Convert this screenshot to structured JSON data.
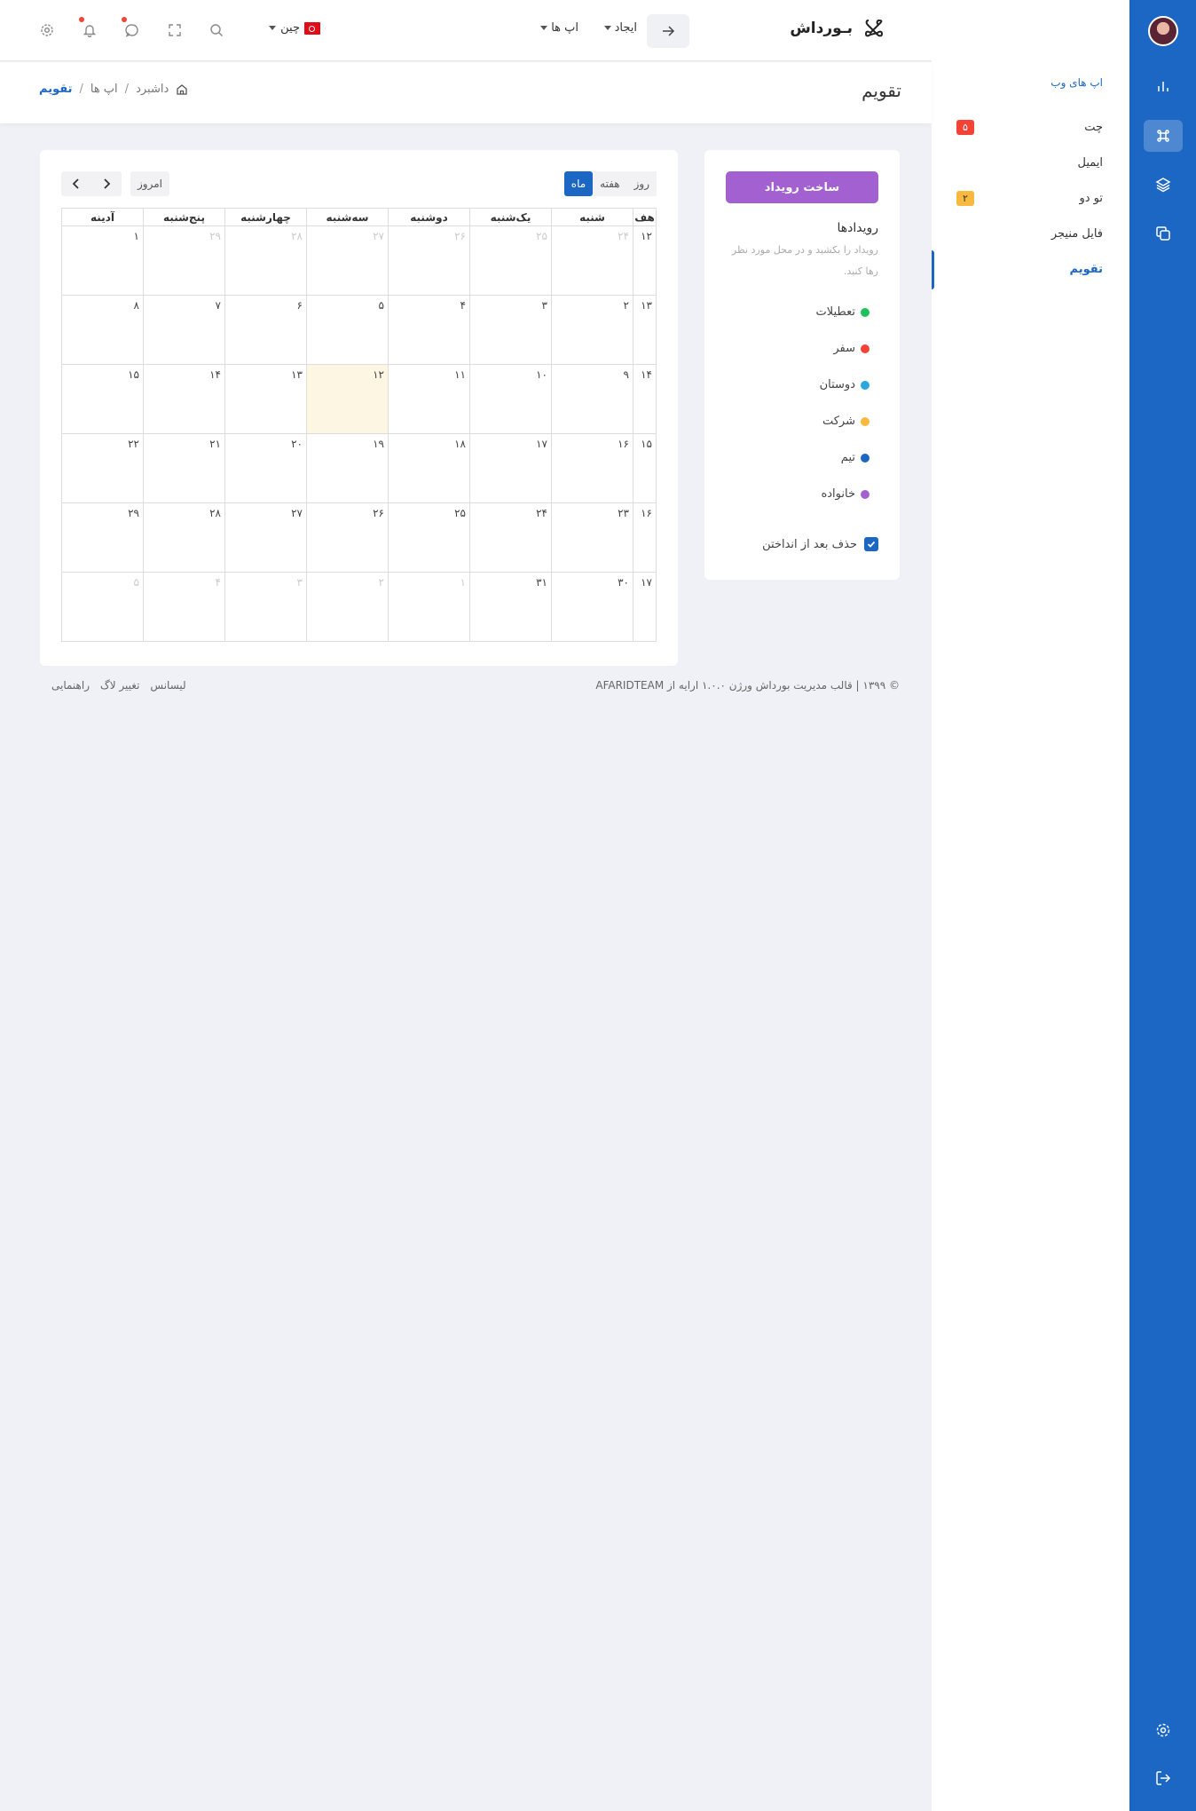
{
  "sidebar_rail": {
    "icons": [
      "chart-icon",
      "command-icon",
      "layers-icon",
      "copy-icon"
    ],
    "bottom_icons": [
      "settings-icon",
      "logout-icon"
    ]
  },
  "subnav": {
    "section_title": "اپ های وب",
    "items": [
      {
        "label": "چت",
        "badge": "۵"
      },
      {
        "label": "ایمیل",
        "badge": ""
      },
      {
        "label": "تو دو",
        "badge": "۲"
      },
      {
        "label": "فایل منیجر",
        "badge": ""
      },
      {
        "label": "تقویم",
        "badge": ""
      }
    ]
  },
  "header": {
    "logo": "بـورداش",
    "menu_create": "ایجاد",
    "menu_apps": "اپ ها",
    "language": "چین"
  },
  "page": {
    "title": "تقویم",
    "breadcrumb": [
      "داشبرد",
      "اپ ها",
      "تقویم"
    ],
    "breadcrumb_sep": "/"
  },
  "events": {
    "create_button": "ساخت رویداد",
    "title": "رویدادها",
    "hint": "رویداد را بکشید و در محل مورد نظر رها کنید.",
    "categories": [
      {
        "label": "تعطیلات",
        "color": "#1ec25a"
      },
      {
        "label": "سفر",
        "color": "#f44336"
      },
      {
        "label": "دوستان",
        "color": "#29a8e0"
      },
      {
        "label": "شرکت",
        "color": "#f9b93f"
      },
      {
        "label": "تیم",
        "color": "#1b67c3"
      },
      {
        "label": "خانواده",
        "color": "#a260d1"
      }
    ],
    "remove_after_drop": "حذف بعد از انداختن"
  },
  "calendar": {
    "views": [
      "روز",
      "هفته",
      "ماه"
    ],
    "active_view": "ماه",
    "today_button": "امروز",
    "headers": [
      "هف",
      "شنبه",
      "یک‌شنبه",
      "دوشنبه",
      "سه‌شنبه",
      "چهارشنبه",
      "پنج‌شنبه",
      "آدینه"
    ],
    "weeks": [
      {
        "week": "۱۲",
        "days": [
          "۲۴",
          "۲۵",
          "۲۶",
          "۲۷",
          "۲۸",
          "۲۹",
          "۱"
        ]
      },
      {
        "week": "۱۳",
        "days": [
          "۲",
          "۳",
          "۴",
          "۵",
          "۶",
          "۷",
          "۸"
        ]
      },
      {
        "week": "۱۴",
        "days": [
          "۹",
          "۱۰",
          "۱۱",
          "۱۲",
          "۱۳",
          "۱۴",
          "۱۵"
        ]
      },
      {
        "week": "۱۵",
        "days": [
          "۱۶",
          "۱۷",
          "۱۸",
          "۱۹",
          "۲۰",
          "۲۱",
          "۲۲"
        ]
      },
      {
        "week": "۱۶",
        "days": [
          "۲۳",
          "۲۴",
          "۲۵",
          "۲۶",
          "۲۷",
          "۲۸",
          "۲۹"
        ]
      },
      {
        "week": "۱۷",
        "days": [
          "۳۰",
          "۳۱",
          "۱",
          "۲",
          "۳",
          "۴",
          "۵"
        ]
      }
    ]
  },
  "footer": {
    "copyright": "© ۱۳۹۹ | قالب مدیریت بورداش ورژن ۱.۰.۰ ارایه از AFARIDTEAM",
    "links": [
      "لیسانس",
      "تغییر لاگ",
      "راهنمایی"
    ]
  }
}
